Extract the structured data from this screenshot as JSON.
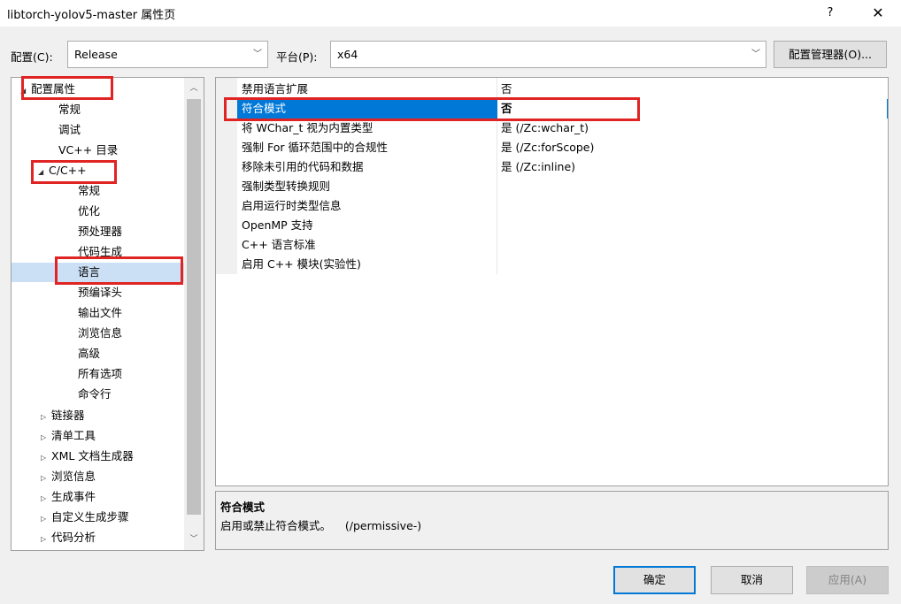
{
  "window": {
    "title": "libtorch-yolov5-master 属性页",
    "help": "?",
    "close": "✕"
  },
  "toolbar": {
    "config_label": "配置(C):",
    "config_value": "Release",
    "platform_label": "平台(P):",
    "platform_value": "x64",
    "manager_button": "配置管理器(O)..."
  },
  "tree": {
    "root": "配置属性",
    "items": [
      "常规",
      "调试",
      "VC++ 目录"
    ],
    "cpp": "C/C++",
    "cpp_items": [
      "常规",
      "优化",
      "预处理器",
      "代码生成",
      "语言",
      "预编译头",
      "输出文件",
      "浏览信息",
      "高级",
      "所有选项",
      "命令行"
    ],
    "collapsed": [
      "链接器",
      "清单工具",
      "XML 文档生成器",
      "浏览信息",
      "生成事件",
      "自定义生成步骤",
      "代码分析"
    ],
    "selected": "语言"
  },
  "grid": {
    "rows": [
      {
        "name": "禁用语言扩展",
        "value": "否"
      },
      {
        "name": "符合模式",
        "value": "否"
      },
      {
        "name": "将 WChar_t 视为内置类型",
        "value": "是 (/Zc:wchar_t)"
      },
      {
        "name": "强制 For 循环范围中的合规性",
        "value": "是 (/Zc:forScope)"
      },
      {
        "name": "移除未引用的代码和数据",
        "value": "是 (/Zc:inline)"
      },
      {
        "name": "强制类型转换规则",
        "value": ""
      },
      {
        "name": "启用运行时类型信息",
        "value": ""
      },
      {
        "name": "OpenMP 支持",
        "value": ""
      },
      {
        "name": "C++ 语言标准",
        "value": ""
      },
      {
        "name": "启用 C++ 模块(实验性)",
        "value": ""
      }
    ]
  },
  "description": {
    "title": "符合模式",
    "text": "启用或禁止符合模式。    (/permissive-)"
  },
  "buttons": {
    "ok": "确定",
    "cancel": "取消",
    "apply": "应用(A)"
  },
  "colors": {
    "accent": "#0078d7",
    "highlight": "#e02424"
  }
}
